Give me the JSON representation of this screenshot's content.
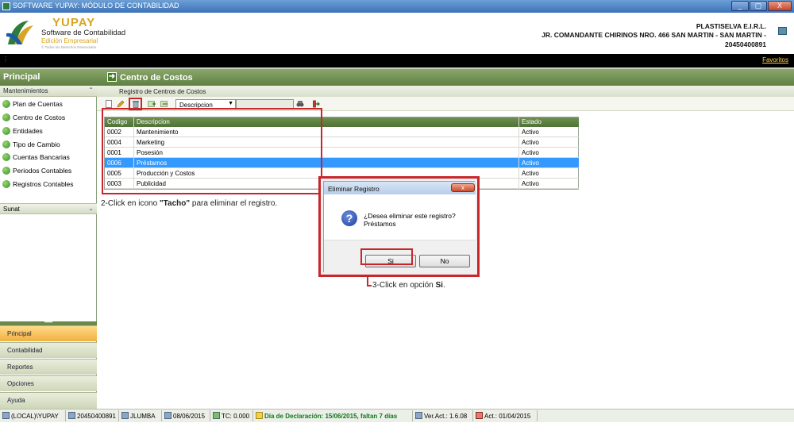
{
  "window": {
    "title": "SOFTWARE YUPAY: MÓDULO DE CONTABILIDAD",
    "min": "_",
    "max": "▢",
    "close": "X"
  },
  "brand": {
    "name": "YUPAY",
    "subtitle": "Software de Contabilidad",
    "edition": "Edición Empresarial",
    "rights": "© Todos los Derechos Reservados"
  },
  "company": {
    "name": "PLASTISELVA E.I.R.L.",
    "address": "JR. COMANDANTE CHIRINOS NRO. 466 SAN MARTIN - SAN MARTIN -",
    "ruc": "20450400891"
  },
  "favorites": "Favoritos",
  "sidebar": {
    "title": "Principal",
    "section": "Mantenimientos",
    "items": [
      {
        "label": "Plan de Cuentas"
      },
      {
        "label": "Centro de Costos"
      },
      {
        "label": "Entidades"
      },
      {
        "label": "Tipo de Cambio"
      },
      {
        "label": "Cuentas Bancarias"
      },
      {
        "label": "Periodos Contables"
      },
      {
        "label": "Registros Contables"
      }
    ],
    "section2": "Sunat",
    "grip": "•••••",
    "nav": [
      {
        "label": "Principal"
      },
      {
        "label": "Contabilidad"
      },
      {
        "label": "Reportes"
      },
      {
        "label": "Opciones"
      },
      {
        "label": "Ayuda"
      }
    ]
  },
  "content": {
    "title": "Centro de Costos",
    "subtitle": "Registro de Centros de Costos",
    "filter_field": "Descripcion"
  },
  "grid": {
    "columns": [
      "Codigo",
      "Descripcion",
      "Estado"
    ],
    "rows": [
      {
        "codigo": "0002",
        "descripcion": "Mantenimiento",
        "estado": "Activo"
      },
      {
        "codigo": "0004",
        "descripcion": "Marketing",
        "estado": "Activo"
      },
      {
        "codigo": "0001",
        "descripcion": "Posesión",
        "estado": "Activo"
      },
      {
        "codigo": "0006",
        "descripcion": "Préstamos",
        "estado": "Activo"
      },
      {
        "codigo": "0005",
        "descripcion": "Producción y Costos",
        "estado": "Activo"
      },
      {
        "codigo": "0003",
        "descripcion": "Publicidad",
        "estado": "Activo"
      }
    ]
  },
  "annotations": {
    "step2_prefix": "2-Click en icono ",
    "step2_bold": "\"Tacho\"",
    "step2_suffix": " para eliminar el registro.",
    "step3_prefix": "3-Click en opción ",
    "step3_bold": "Si",
    "step3_suffix": "."
  },
  "dialog": {
    "title": "Eliminar Registro",
    "close": "x",
    "icon": "?",
    "message_line1": "¿Desea eliminar este registro?",
    "message_line2": "Préstamos",
    "yes": "Si",
    "no": "No"
  },
  "status": {
    "server": "(LOCAL)\\YUPAY",
    "ruc": "20450400891",
    "user": "JLUMBA",
    "date": "08/06/2015",
    "tc": "TC: 0.000",
    "declaration": "Día de Declaración: 15/06/2015, faltan 7 días",
    "version": "Ver.Act.: 1.6.08",
    "update": "Act.: 01/04/2015"
  }
}
